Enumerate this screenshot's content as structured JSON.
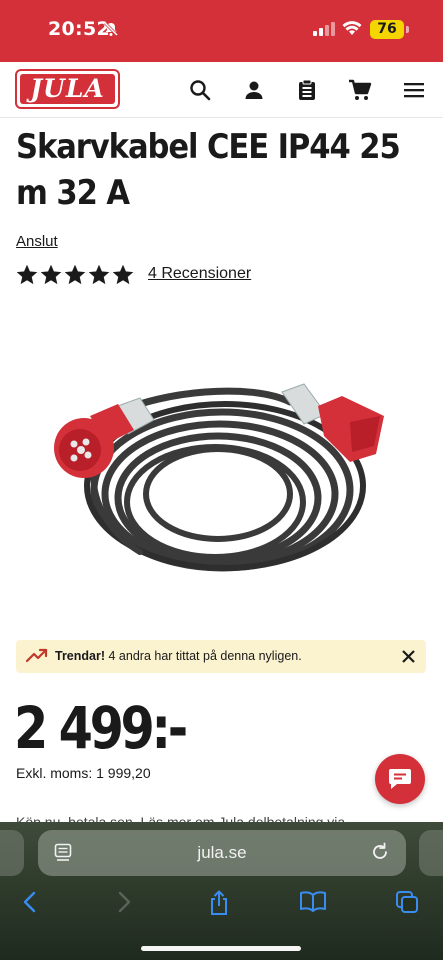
{
  "status": {
    "time": "20:52",
    "battery": "76"
  },
  "header": {
    "logo": "JULA"
  },
  "product": {
    "title": "Skarvkabel CEE IP44 25 m 32 A",
    "brand": "Anslut",
    "rating": 5,
    "rating_max": 5,
    "reviews": "4 Recensioner"
  },
  "trend": {
    "bold": "Trendar!",
    "text": "4 andra har tittat på denna nyligen."
  },
  "price": {
    "main": "2 499:-",
    "ex_vat": "Exkl. moms: 1 999,20"
  },
  "partial_text": "Köp nu, betala sen. Läs mer om Jula delbetalning via",
  "browser": {
    "url": "jula.se"
  },
  "colors": {
    "brand_red": "#d4303a",
    "banner_bg": "#fbf2cf",
    "accent_red": "#d4303a"
  }
}
